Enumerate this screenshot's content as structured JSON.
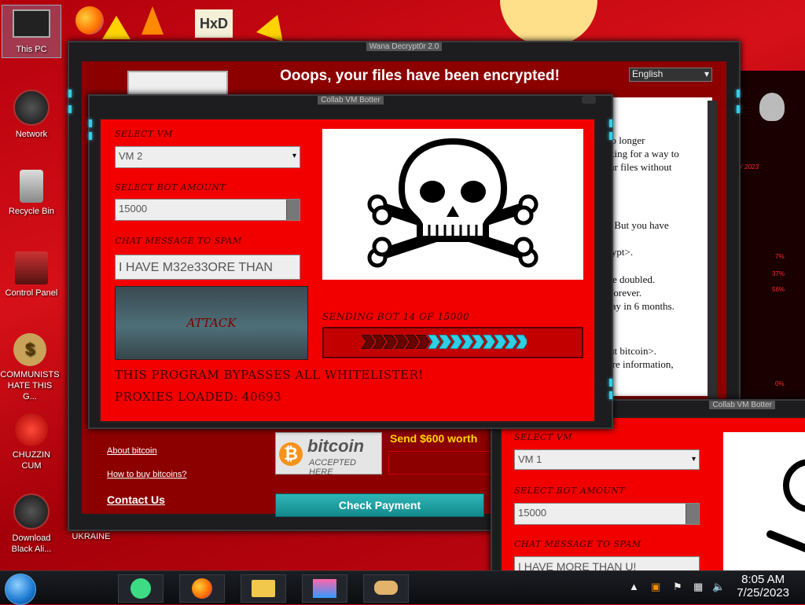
{
  "desktop": {
    "icons": [
      {
        "label": "This PC"
      },
      {
        "label": "Network"
      },
      {
        "label": "Recycle Bin"
      },
      {
        "label": "Control Panel"
      },
      {
        "label": "COMMUNISTS HATE THIS G..."
      },
      {
        "label": "CHUZZIN CUM"
      },
      {
        "label": "Download Black Ali..."
      },
      {
        "label": "UKRAINE"
      }
    ]
  },
  "wannacry": {
    "title": "Wana Decrypt0r 2.0",
    "headline": "Ooops, your files have been encrypted!",
    "language": "English",
    "text_lines": [
      "e no longer",
      "ooking for a way to",
      "your files without",
      "ily. But you have",
      "ecrypt>.",
      "ll be doubled.",
      "es forever.",
      "'t pay in 6 months.",
      "bout bitcoin>.",
      "more information,"
    ],
    "links": {
      "about": "About bitcoin",
      "howto": "How to buy bitcoins?",
      "contact": "Contact Us"
    },
    "bitcoin_logo": {
      "word": "bitcoin",
      "sub": "ACCEPTED HERE"
    },
    "send_text": "Send $600 worth",
    "check_payment": "Check Payment"
  },
  "botter1": {
    "title": "Collab VM Botter",
    "select_vm_label": "SELECT VM",
    "select_vm_value": "VM 2",
    "bot_amount_label": "SELECT BOT AMOUNT",
    "bot_amount_value": "15000",
    "chat_label": "CHAT MESSAGE TO SPAM",
    "chat_value": "I HAVE M32e33ORE THAN",
    "attack_label": "ATTACK",
    "sending_text": "SENDING BOT 14 OF 15000",
    "progress": 0.0009,
    "bypass_text": "THIS PROGRAM BYPASSES ALL WHITELISTER!",
    "proxies_text": "PROXIES LOADED: 40693"
  },
  "botter2": {
    "title": "Collab VM Botter",
    "select_vm_label": "SELECT VM",
    "select_vm_value": "VM 1",
    "bot_amount_label": "SELECT BOT AMOUNT",
    "bot_amount_value": "15000",
    "chat_label": "CHAT MESSAGE TO SPAM",
    "chat_value": "I HAVE MORE THAN U!"
  },
  "alien_panel": {
    "stats": [
      "7%",
      "37%",
      "56%",
      "0%"
    ],
    "date": "LY 2023"
  },
  "taskbar": {
    "time": "8:05 AM",
    "date": "7/25/2023"
  },
  "colors": {
    "accent_cyan": "#2fd0e6",
    "bot_red": "#f20000",
    "wannacry_red": "#8c0000"
  }
}
